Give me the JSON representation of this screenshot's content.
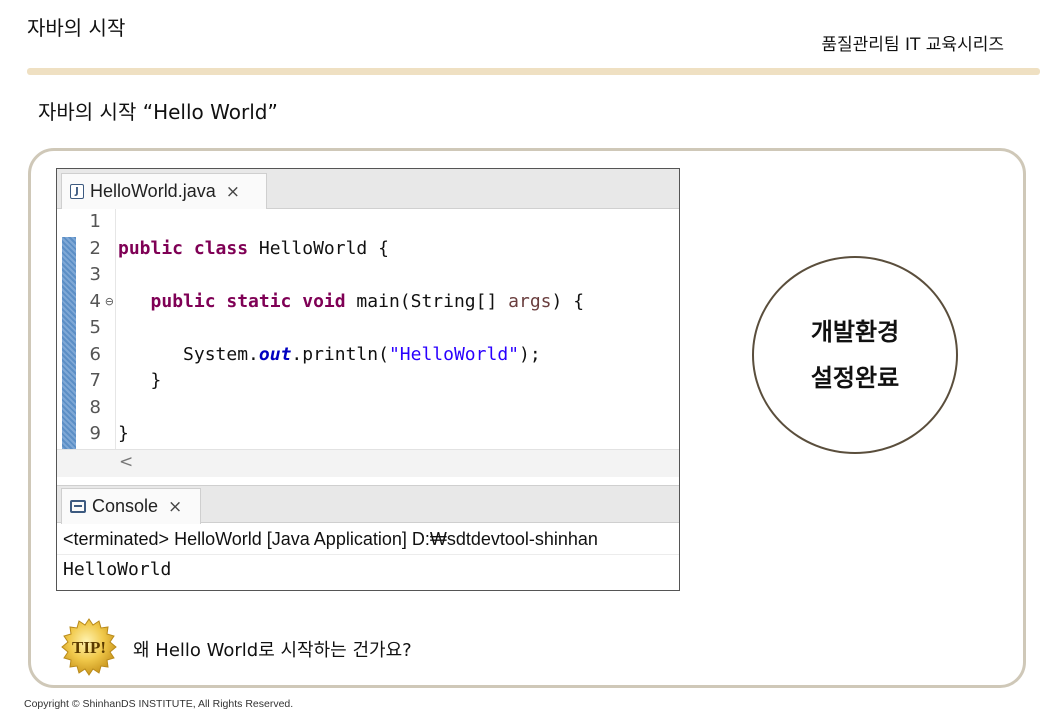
{
  "header": {
    "title": "자바의 시작",
    "series": "품질관리팀 IT 교육시리즈"
  },
  "slide": {
    "subtitle": "자바의 시작 “Hello World”"
  },
  "editor": {
    "tab_label": "HelloWorld.java",
    "tab_icon": "java-file-icon",
    "close_glyph": "×",
    "line_numbers": [
      "1",
      "2",
      "3",
      "4",
      "5",
      "6",
      "7",
      "8",
      "9"
    ],
    "fold_marker": "⊖",
    "code": {
      "l2_kw": "public class",
      "l2_rest": " HelloWorld {",
      "l4_kw": "public static void",
      "l4_mid": " main(String[] ",
      "l4_param": "args",
      "l4_end": ") {",
      "l6_pre": "System.",
      "l6_field": "out",
      "l6_mid": ".println(",
      "l6_str": "\"HelloWorld\"",
      "l6_end": ");",
      "l7": "}",
      "l9": "}"
    },
    "scroll_left": "<"
  },
  "console": {
    "tab_label": "Console",
    "close_glyph": "×",
    "status": "<terminated> HelloWorld [Java Application] D:₩sdtdevtool-shinhan",
    "output": "HelloWorld"
  },
  "callout": {
    "line1": "개발환경",
    "line2": "설정완료"
  },
  "tip": {
    "badge": "TIP!",
    "text": "왜 Hello World로 시작하는 건가요?"
  },
  "footer": {
    "copyright": "Copyright © ShinhanDS INSTITUTE, All Rights Reserved."
  },
  "colors": {
    "accent_bar": "#efe0c2",
    "frame_border": "#cfc8b8",
    "keyword": "#7f0055",
    "string": "#2a00ff",
    "field": "#0000c0",
    "tip_gold": "#e2b43a"
  }
}
